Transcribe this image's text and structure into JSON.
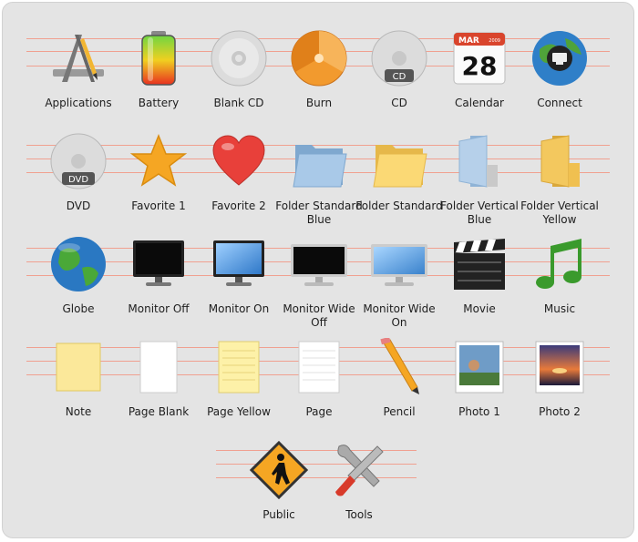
{
  "rows": [
    [
      "Applications",
      "Battery",
      "Blank CD",
      "Burn",
      "CD",
      "Calendar",
      "Connect"
    ],
    [
      "DVD",
      "Favorite 1",
      "Favorite 2",
      "Folder Standard Blue",
      "Folder Standard",
      "Folder Vertical Blue",
      "Folder Vertical Yellow"
    ],
    [
      "Globe",
      "Monitor Off",
      "Monitor On",
      "Monitor Wide Off",
      "Monitor Wide On",
      "Movie",
      "Music"
    ],
    [
      "Note",
      "Page Blank",
      "Page Yellow",
      "Page",
      "Pencil",
      "Photo 1",
      "Photo 2"
    ],
    [
      "Public",
      "Tools"
    ]
  ],
  "icon_names": [
    [
      "applications-icon",
      "battery-icon",
      "blank-cd-icon",
      "burn-icon",
      "cd-icon",
      "calendar-icon",
      "connect-icon"
    ],
    [
      "dvd-icon",
      "favorite-star-icon",
      "favorite-heart-icon",
      "folder-blue-icon",
      "folder-yellow-icon",
      "folder-vertical-blue-icon",
      "folder-vertical-yellow-icon"
    ],
    [
      "globe-icon",
      "monitor-off-icon",
      "monitor-on-icon",
      "monitor-wide-off-icon",
      "monitor-wide-on-icon",
      "movie-clapper-icon",
      "music-note-icon"
    ],
    [
      "note-icon",
      "page-blank-icon",
      "page-yellow-icon",
      "page-lined-icon",
      "pencil-icon",
      "photo-1-icon",
      "photo-2-icon"
    ],
    [
      "public-sign-icon",
      "tools-icon"
    ]
  ],
  "disc_labels": {
    "cd": "CD",
    "dvd": "DVD"
  },
  "calendar": {
    "month": "MAR",
    "year": "2009",
    "day": "28"
  },
  "colors": {
    "panel": "#e4e4e4",
    "guide": "#f0a090",
    "label": "#1e1e1e"
  }
}
